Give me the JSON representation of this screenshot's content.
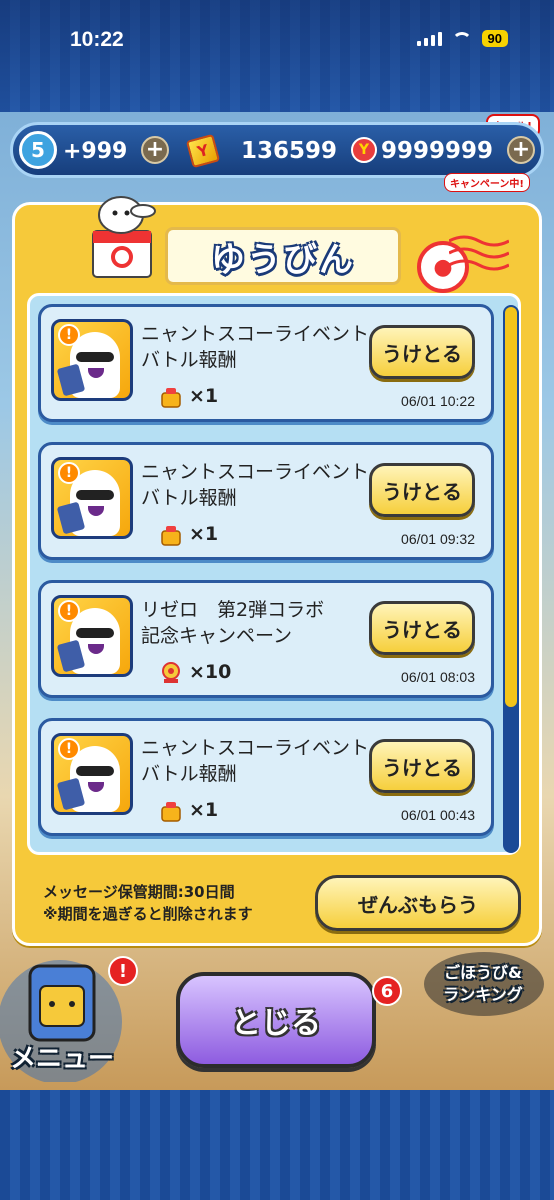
{
  "status_bar": {
    "time": "10:22",
    "battery": "90"
  },
  "currency": {
    "level": "5",
    "energy": "+999",
    "coins": "136599",
    "gems": "9999999",
    "coin_symbol": "Y",
    "gem_symbol": "Y",
    "sale_tag": "セール!",
    "campaign_tag": "キャンペーン中!"
  },
  "mail": {
    "title": "ゆうびん",
    "items": [
      {
        "title": "ニャントスコーライベント\nバトル報酬",
        "qty": "×1",
        "date": "06/01 10:22",
        "button": "うけとる"
      },
      {
        "title": "ニャントスコーライベント\nバトル報酬",
        "qty": "×1",
        "date": "06/01 09:32",
        "button": "うけとる"
      },
      {
        "title": "リゼロ　第2弾コラボ\n記念キャンペーン",
        "qty": "×10",
        "date": "06/01 08:03",
        "button": "うけとる"
      },
      {
        "title": "ニャントスコーライベント\nバトル報酬",
        "qty": "×1",
        "date": "06/01 00:43",
        "button": "うけとる"
      }
    ],
    "footer_line1": "メッセージ保管期間:30日間",
    "footer_line2": "※期間を過ぎると削除されます",
    "claim_all": "ぜんぶもらう",
    "scroll_position": 0.0
  },
  "bottom": {
    "menu": "メニュー",
    "menu_badge": "!",
    "close": "とじる",
    "mid_badge": "6",
    "reward_ranking": "ごほうび&\nランキング"
  },
  "colors": {
    "panel": "#f6c93a",
    "list_bg": "#b5dff3",
    "button": "#f6cf3c",
    "close_button": "#8e5ce0"
  }
}
